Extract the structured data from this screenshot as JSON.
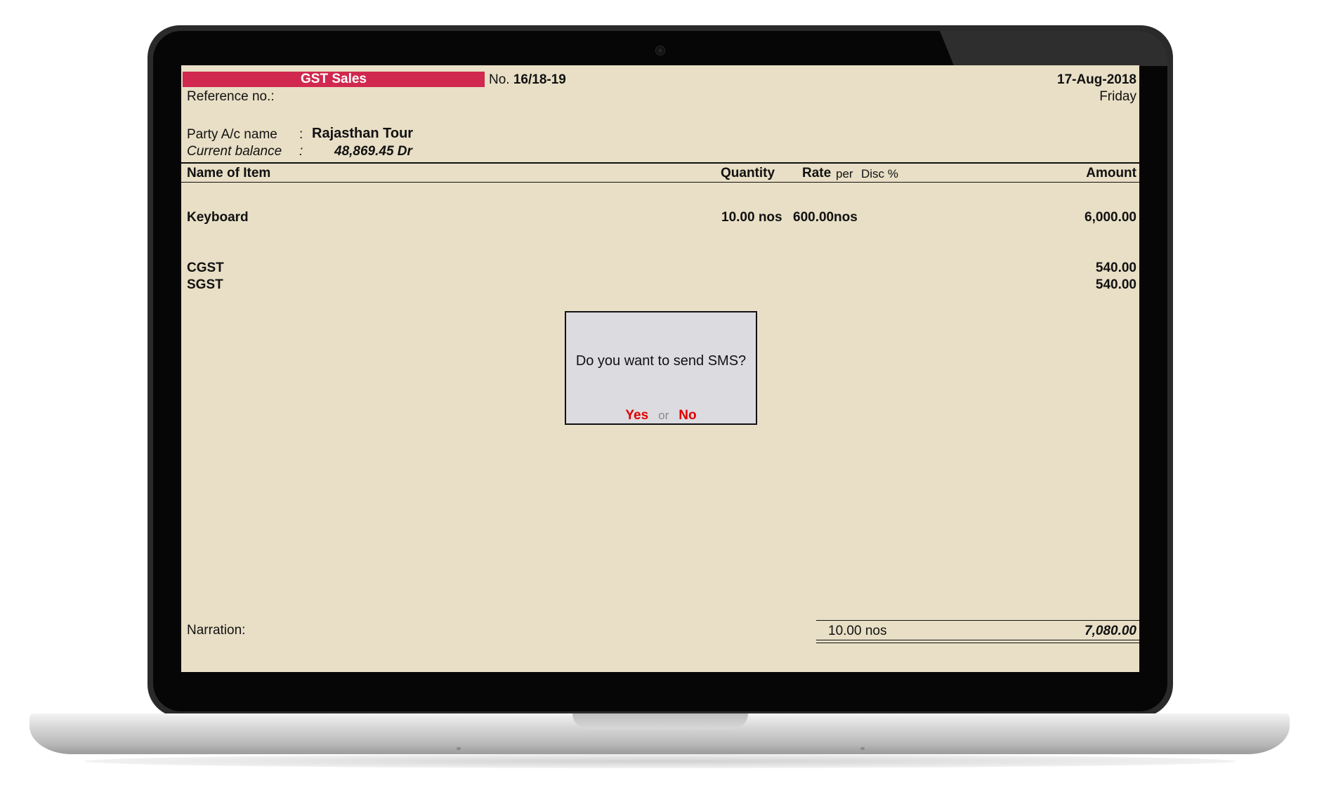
{
  "voucher": {
    "type": "GST Sales",
    "no_label": "No.",
    "no_value": "16/18-19",
    "date": "17-Aug-2018",
    "day": "Friday",
    "reference_label": "Reference no.:"
  },
  "party": {
    "name_label": "Party A/c name",
    "name_value": "Rajasthan Tour",
    "balance_label": "Current balance",
    "balance_value": "48,869.45 Dr",
    "colon": ":"
  },
  "columns": {
    "name": "Name of Item",
    "quantity": "Quantity",
    "rate": "Rate",
    "per": "per",
    "disc": "Disc %",
    "amount": "Amount"
  },
  "items": [
    {
      "name": "Keyboard",
      "quantity": "10.00 nos",
      "rate": "600.00",
      "per": "nos",
      "amount": "6,000.00"
    }
  ],
  "taxes": [
    {
      "name": "CGST",
      "amount": "540.00"
    },
    {
      "name": "SGST",
      "amount": "540.00"
    }
  ],
  "footer": {
    "narration_label": "Narration:",
    "total_quantity": "10.00 nos",
    "total_amount": "7,080.00"
  },
  "dialog": {
    "question": "Do you want to send SMS?",
    "yes": "Yes",
    "or": "or",
    "no": "No"
  },
  "colors": {
    "voucher_bar": "#d0284f",
    "screen_bg": "#e8dfc6",
    "dialog_bg": "#dcdbe0",
    "option_red": "#e00000"
  }
}
